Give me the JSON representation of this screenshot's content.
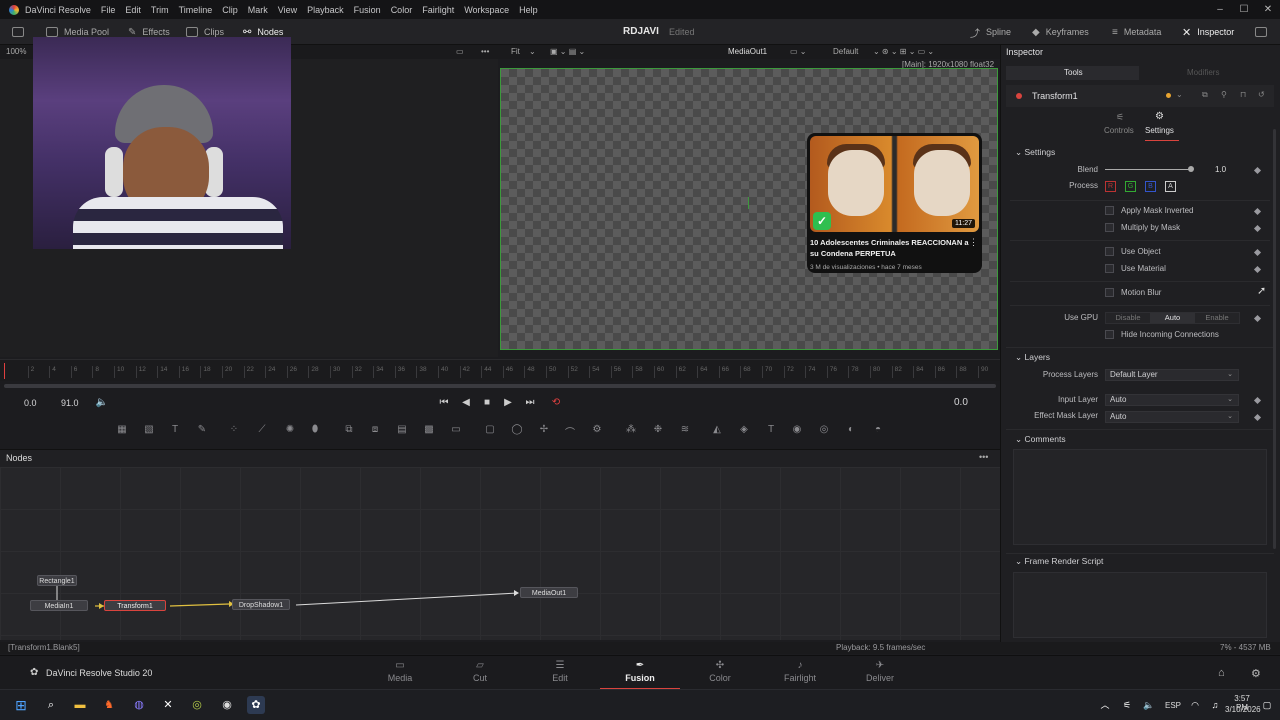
{
  "menubar": {
    "items": [
      "DaVinci Resolve",
      "File",
      "Edit",
      "Trim",
      "Timeline",
      "Clip",
      "Mark",
      "View",
      "Playback",
      "Fusion",
      "Color",
      "Fairlight",
      "Workspace",
      "Help"
    ]
  },
  "toolbar": {
    "media_pool": "Media Pool",
    "effects": "Effects",
    "clips": "Clips",
    "nodes": "Nodes",
    "project_title": "RDJAVI",
    "project_status": "Edited",
    "spline": "Spline",
    "keyframes": "Keyframes",
    "metadata": "Metadata",
    "inspector": "Inspector"
  },
  "viewer": {
    "zoom": "100%",
    "fit": "Fit",
    "output_name": "MediaOut1",
    "lut": "Default",
    "resolution": "[Main]: 1920x1080 float32"
  },
  "video_card": {
    "duration": "11:27",
    "title": "10 Adolescentes Criminales REACCIONAN a su Condena PERPETUA",
    "meta": "3 M de visualizaciones • hace 7 meses"
  },
  "ruler": {
    "ticks": [
      "2",
      "4",
      "6",
      "8",
      "10",
      "12",
      "14",
      "16",
      "18",
      "20",
      "22",
      "24",
      "26",
      "28",
      "30",
      "32",
      "34",
      "36",
      "38",
      "40",
      "42",
      "44",
      "46",
      "48",
      "50",
      "52",
      "54",
      "56",
      "58",
      "60",
      "62",
      "64",
      "66",
      "68",
      "70",
      "72",
      "74",
      "76",
      "78",
      "80",
      "82",
      "84",
      "86",
      "88",
      "90"
    ]
  },
  "transport": {
    "start": "0.0",
    "end": "91.0",
    "current": "0.0"
  },
  "nodes": {
    "title": "Nodes",
    "items": [
      "Rectangle1",
      "MediaIn1",
      "Transform1",
      "DropShadow1",
      "MediaOut1"
    ]
  },
  "status": {
    "left": "[Transform1.Blank5]",
    "playback": "Playback: 9.5 frames/sec",
    "memory": "7% - 4537 MB"
  },
  "pagebar": {
    "app_name": "DaVinci Resolve Studio 20",
    "tabs": [
      "Media",
      "Cut",
      "Edit",
      "Fusion",
      "Color",
      "Fairlight",
      "Deliver"
    ],
    "active": "Fusion"
  },
  "inspector": {
    "title": "Inspector",
    "tab_tools": "Tools",
    "tab_modifiers": "Modifiers",
    "tool_name": "Transform1",
    "subtab_controls": "Controls",
    "subtab_settings": "Settings",
    "settings_section": "Settings",
    "blend_label": "Blend",
    "blend_value": "1.0",
    "blend_level": 1.0,
    "process_label": "Process",
    "channels": [
      "R",
      "G",
      "B",
      "A"
    ],
    "apply_mask_inverted": "Apply Mask Inverted",
    "multiply_by_mask": "Multiply by Mask",
    "use_object": "Use Object",
    "use_material": "Use Material",
    "motion_blur": "Motion Blur",
    "use_gpu_label": "Use GPU",
    "gpu_options": [
      "Disable",
      "Auto",
      "Enable"
    ],
    "gpu_selected": "Auto",
    "hide_incoming": "Hide Incoming Connections",
    "layers_section": "Layers",
    "process_layers_label": "Process Layers",
    "process_layers_value": "Default Layer",
    "input_layer_label": "Input Layer",
    "input_layer_value": "Auto",
    "effect_mask_label": "Effect Mask Layer",
    "effect_mask_value": "Auto",
    "comments_section": "Comments",
    "frame_render_section": "Frame Render Script"
  },
  "taskbar": {
    "language": "ESP",
    "time": "3:57 PM",
    "date": "3/10/2026"
  },
  "colors": {
    "accent_red": "#d9443e",
    "canvas_border": "#3c9a3c",
    "check_green": "#2fbf4f"
  }
}
